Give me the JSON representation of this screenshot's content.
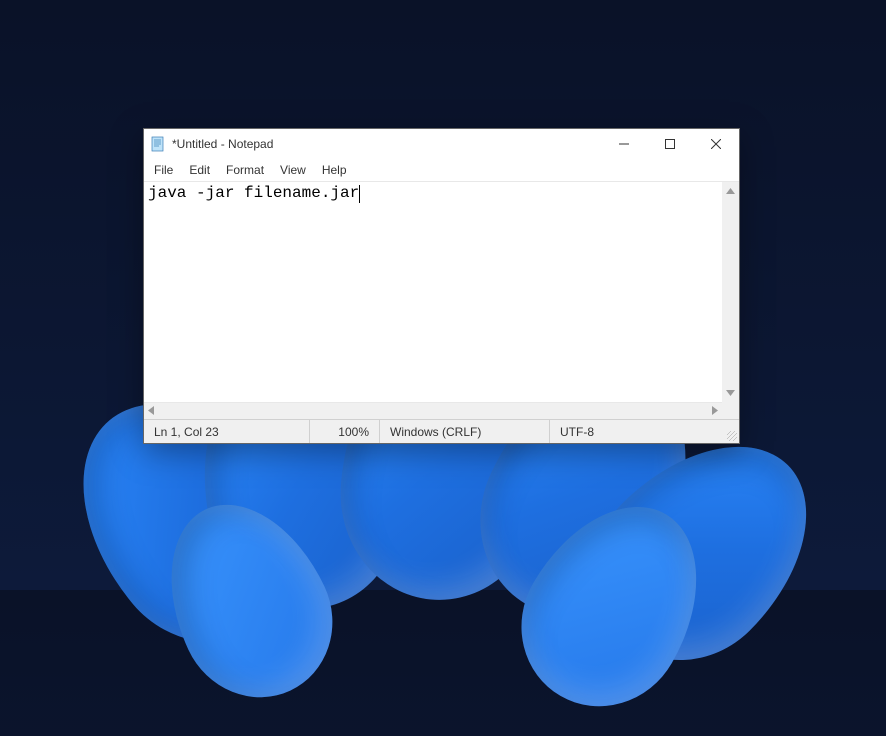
{
  "titlebar": {
    "title": "*Untitled - Notepad"
  },
  "menus": {
    "file": "File",
    "edit": "Edit",
    "format": "Format",
    "view": "View",
    "help": "Help"
  },
  "editor": {
    "content": "java -jar filename.jar"
  },
  "status": {
    "cursor": "Ln 1, Col 23",
    "zoom": "100%",
    "line_ending": "Windows (CRLF)",
    "encoding": "UTF-8"
  }
}
